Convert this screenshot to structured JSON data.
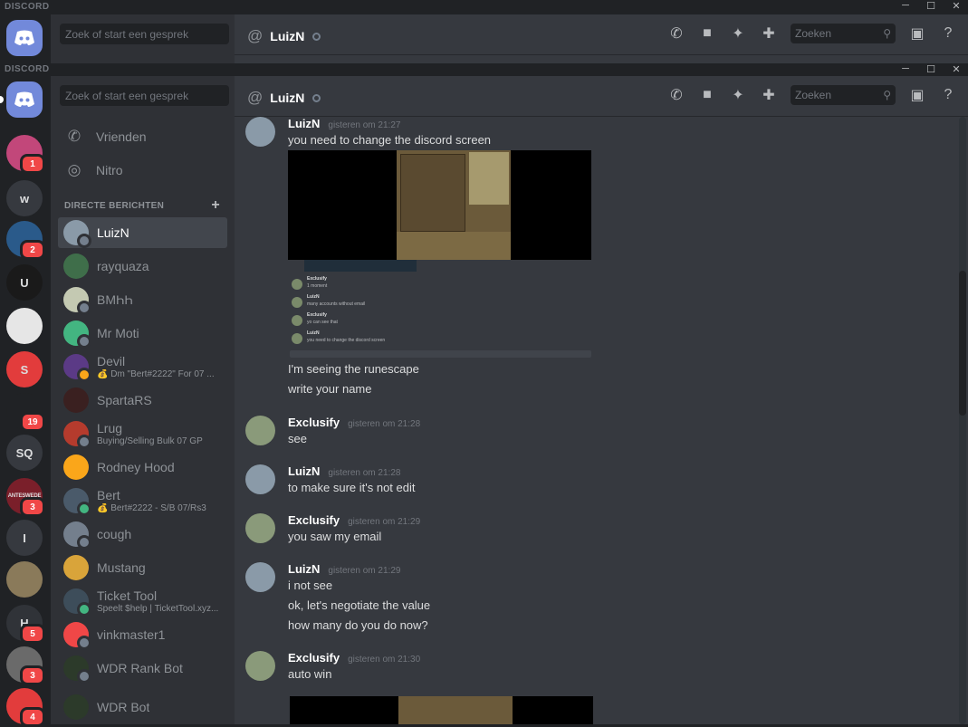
{
  "brand": "DISCORD",
  "window_controls": [
    "─",
    "☐",
    "✕"
  ],
  "search_placeholder": "Zoek of start een gesprek",
  "nav": [
    {
      "label": "Vrienden",
      "icon": "friends-icon"
    },
    {
      "label": "Nitro",
      "icon": "nitro-icon"
    }
  ],
  "dm_header": "DIRECTE BERICHTEN",
  "dm_add": "+",
  "dms": [
    {
      "name": "LuizN",
      "sub": "",
      "color": "#8a9aa8",
      "status": "#747f8d",
      "active": true
    },
    {
      "name": "rayquaza",
      "sub": "",
      "color": "#3f6e4a",
      "status": "",
      "active": false
    },
    {
      "name": "BMҺҺ",
      "sub": "",
      "color": "#c4c9b2",
      "status": "#747f8d",
      "active": false
    },
    {
      "name": "Mr Moti",
      "sub": "",
      "color": "#43b581",
      "status": "#747f8d",
      "active": false
    },
    {
      "name": "Devil",
      "sub": "💰 Dm \"Bert#2222\" For 07 ...",
      "color": "#5b3a86",
      "status": "#faa61a",
      "active": false
    },
    {
      "name": "SpartaRS",
      "sub": "",
      "color": "#3a2020",
      "status": "",
      "active": false
    },
    {
      "name": "Lrug",
      "sub": "Buying/Selling Bulk 07 GP",
      "color": "#b53b2d",
      "status": "#747f8d",
      "active": false
    },
    {
      "name": "Rodney Hood",
      "sub": "",
      "color": "#faa61a",
      "status": "",
      "active": false
    },
    {
      "name": "Bert",
      "sub": "💰 Bert#2222 - S/B 07/Rs3",
      "color": "#4a5a6a",
      "status": "#43b581",
      "active": false
    },
    {
      "name": "cough",
      "sub": "",
      "color": "#747f8d",
      "status": "#747f8d",
      "active": false
    },
    {
      "name": "Mustang",
      "sub": "",
      "color": "#d9a43a",
      "status": "",
      "active": false
    },
    {
      "name": "Ticket Tool",
      "sub": "Speelt $help | TicketTool.xyz...",
      "color": "#3d4d5a",
      "status": "#43b581",
      "active": false
    },
    {
      "name": "vinkmaster1",
      "sub": "",
      "color": "#f04747",
      "status": "#747f8d",
      "active": false
    },
    {
      "name": "WDR Rank Bot",
      "sub": "",
      "color": "#2c3a2a",
      "status": "#747f8d",
      "active": false
    },
    {
      "name": "WDR Bot",
      "sub": "",
      "color": "#2c3a2a",
      "status": "",
      "active": false
    }
  ],
  "guilds": [
    {
      "label": "",
      "color": "#c2477a",
      "badge": "1"
    },
    {
      "label": "w",
      "color": "#36393f",
      "badge": ""
    },
    {
      "label": "",
      "color": "#2a5a8a",
      "badge": "2"
    },
    {
      "label": "U",
      "color": "#1a1a1a",
      "badge": ""
    },
    {
      "label": "",
      "color": "#e6e6e6",
      "badge": ""
    },
    {
      "label": "S",
      "color": "#e23c3c",
      "badge": ""
    },
    {
      "label": "",
      "color": "#202225",
      "badge": "19"
    },
    {
      "label": "SQ",
      "color": "#36393f",
      "badge": ""
    },
    {
      "label": "ANTESWEDE",
      "color": "#7a1f2a",
      "badge": "3"
    },
    {
      "label": "I",
      "color": "#36393f",
      "badge": ""
    },
    {
      "label": "",
      "color": "#8a7a5a",
      "badge": ""
    },
    {
      "label": "H",
      "color": "#303338",
      "badge": "5"
    },
    {
      "label": "",
      "color": "#6a6a6a",
      "badge": "3"
    },
    {
      "label": "",
      "color": "#e23c3c",
      "badge": "4"
    }
  ],
  "chat": {
    "channel": "LuizN",
    "search_placeholder": "Zoeken",
    "tools": [
      {
        "name": "call-icon",
        "glyph": "✆"
      },
      {
        "name": "video-icon",
        "glyph": "■"
      },
      {
        "name": "pin-icon",
        "glyph": "✦"
      },
      {
        "name": "add-member-icon",
        "glyph": "✚"
      }
    ],
    "inbox_glyph": "▣",
    "help_glyph": "?"
  },
  "messages": [
    {
      "author": "LuizN",
      "time": "gisteren om 21:27",
      "lines": [
        "you need to change the discord screen"
      ],
      "avatar": "#8a9aa8"
    },
    {
      "author": "",
      "time": "",
      "lines": [
        "I'm seeing the runescape",
        "write your name"
      ],
      "avatar": ""
    },
    {
      "author": "Exclusify",
      "time": "gisteren om 21:28",
      "lines": [
        "see"
      ],
      "avatar": "#8a9a7a"
    },
    {
      "author": "LuizN",
      "time": "gisteren om 21:28",
      "lines": [
        "to make sure it's not edit"
      ],
      "avatar": "#8a9aa8"
    },
    {
      "author": "Exclusify",
      "time": "gisteren om 21:29",
      "lines": [
        "you saw my email"
      ],
      "avatar": "#8a9a7a"
    },
    {
      "author": "LuizN",
      "time": "gisteren om 21:29",
      "lines": [
        "i not see",
        "ok, let's negotiate the value",
        "how many do you do now?"
      ],
      "avatar": "#8a9aa8"
    },
    {
      "author": "Exclusify",
      "time": "gisteren om 21:30",
      "lines": [
        "auto win"
      ],
      "avatar": "#8a9a7a"
    }
  ],
  "embed_mini": [
    {
      "name": "Exclusify",
      "text": "1 moment"
    },
    {
      "name": "LuizN",
      "text": "many accounts without email"
    },
    {
      "name": "Exclusify",
      "text": "yo can see that"
    },
    {
      "name": "LuizN",
      "text": "you need to change the discord screen"
    }
  ],
  "colors": {
    "accent": "#7289da",
    "online": "#43b581",
    "idle": "#faa61a",
    "dnd": "#f04747",
    "offline": "#747f8d"
  }
}
